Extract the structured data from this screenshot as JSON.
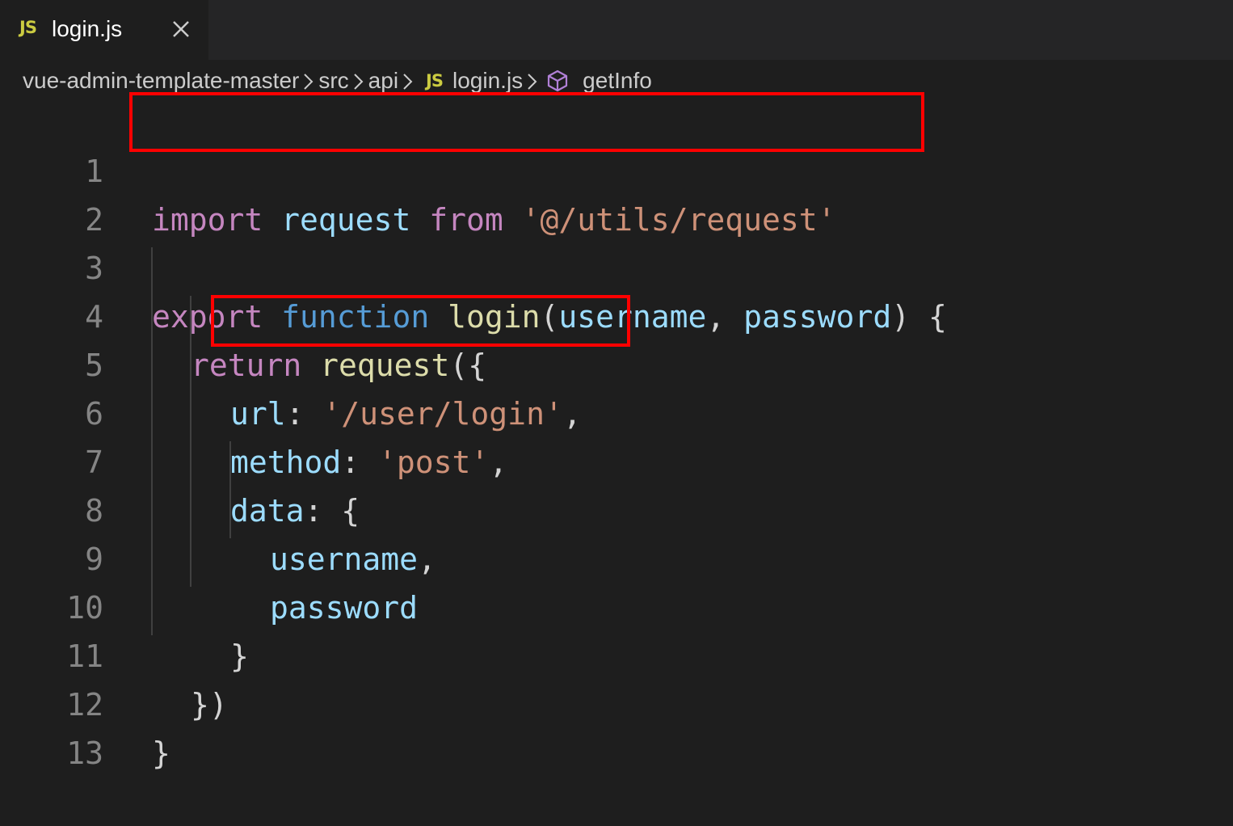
{
  "tab": {
    "icon_label": "JS",
    "title": "login.js",
    "close_icon": "close-icon"
  },
  "breadcrumb": {
    "items": [
      "vue-admin-template-master",
      "src",
      "api",
      "login.js",
      "getInfo"
    ],
    "file_icon_label": "JS",
    "symbol_icon": "cube-icon"
  },
  "code": {
    "line_numbers": [
      "1",
      "2",
      "3",
      "4",
      "5",
      "6",
      "7",
      "8",
      "9",
      "10",
      "11",
      "12",
      "13"
    ],
    "l1": {
      "kw_import": "import",
      "name": "request",
      "kw_from": "from",
      "path": "'@/utils/request'"
    },
    "l3": {
      "kw_export": "export",
      "kw_function": "function",
      "fn_name": "login",
      "open": "(",
      "param1": "username",
      "comma": ", ",
      "param2": "password",
      "close": ")",
      "brace": "{"
    },
    "l4": {
      "kw_return": "return",
      "fn_call": "request",
      "open": "(",
      "brace": "{"
    },
    "l5": {
      "key": "url",
      "colon": ": ",
      "value": "'/user/login'",
      "comma": ","
    },
    "l6": {
      "key": "method",
      "colon": ": ",
      "value": "'post'",
      "comma": ","
    },
    "l7": {
      "key": "data",
      "colon": ": ",
      "brace": "{"
    },
    "l8": {
      "item": "username",
      "comma": ","
    },
    "l9": {
      "item": "password"
    },
    "l10": {
      "brace": "}"
    },
    "l11": {
      "brace": "}",
      "paren": ")"
    },
    "l12": {
      "brace": "}"
    }
  },
  "colors": {
    "highlight": "#ff0000",
    "keyword_control": "#c586c0",
    "keyword_storage": "#569cd6",
    "variable": "#9cdcfe",
    "function": "#dcdcaa",
    "string": "#ce9178"
  }
}
